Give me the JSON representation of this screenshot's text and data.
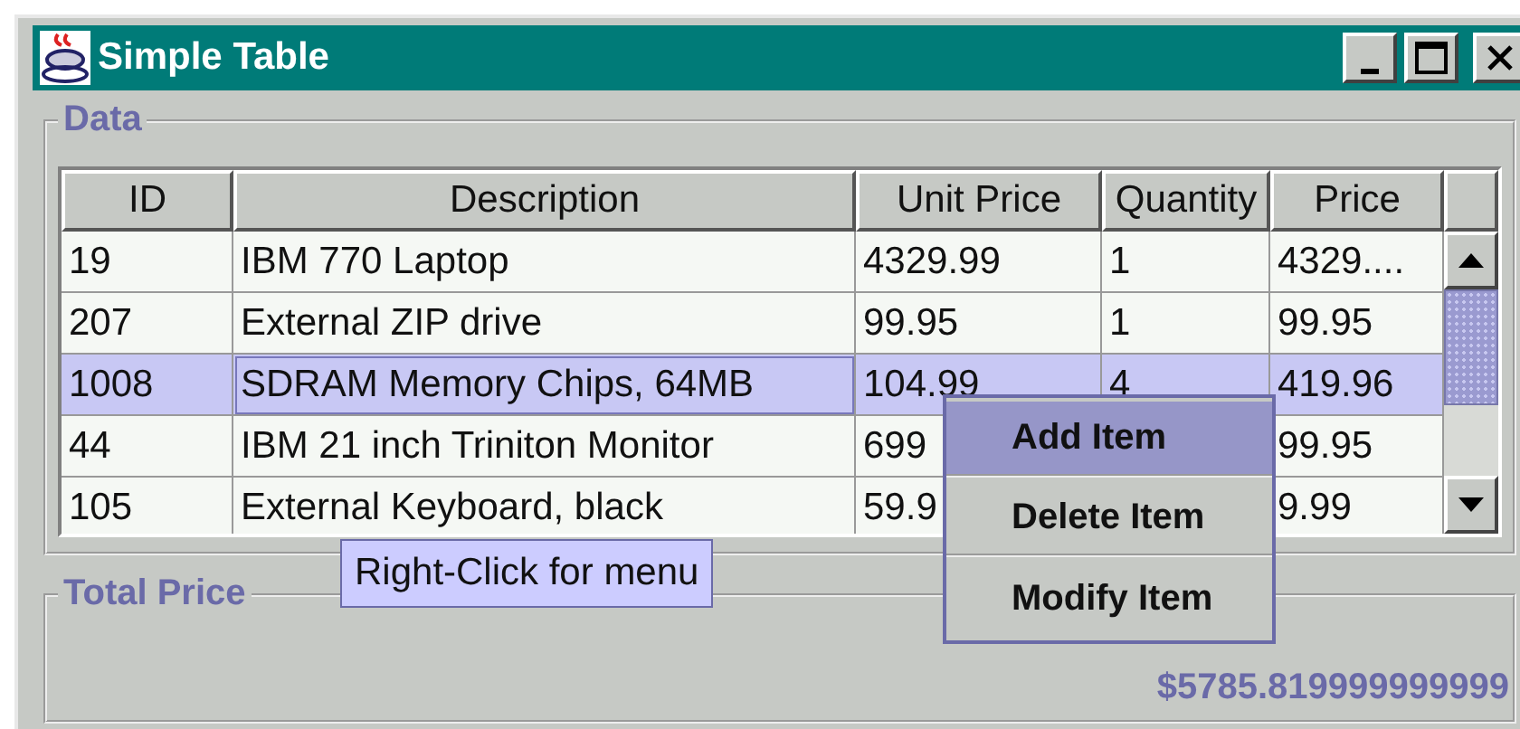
{
  "window": {
    "title": "Simple Table"
  },
  "data_panel": {
    "title": "Data",
    "table": {
      "columns": [
        "ID",
        "Description",
        "Unit Price",
        "Quantity",
        "Price"
      ],
      "rows": [
        {
          "selected": false,
          "cells": [
            "19",
            "IBM 770 Laptop",
            "4329.99",
            "1",
            "4329...."
          ]
        },
        {
          "selected": false,
          "cells": [
            "207",
            "External ZIP drive",
            "99.95",
            "1",
            "99.95"
          ]
        },
        {
          "selected": true,
          "cells": [
            "1008",
            "SDRAM Memory Chips, 64MB",
            "104.99",
            "4",
            "419.96"
          ]
        },
        {
          "selected": false,
          "cells": [
            "44",
            "IBM 21 inch Triniton Monitor",
            "699",
            null,
            "99.95"
          ]
        },
        {
          "selected": false,
          "cells": [
            "105",
            "External Keyboard, black",
            "59.9",
            null,
            "9.99"
          ]
        }
      ]
    }
  },
  "tooltip": "Right-Click for menu",
  "total_panel": {
    "title": "Total Price",
    "value": "$5785.819999999999"
  },
  "context_menu": [
    {
      "label": "Add Item",
      "selected": true
    },
    {
      "label": "Delete Item",
      "selected": false
    },
    {
      "label": "Modify Item",
      "selected": false
    }
  ]
}
